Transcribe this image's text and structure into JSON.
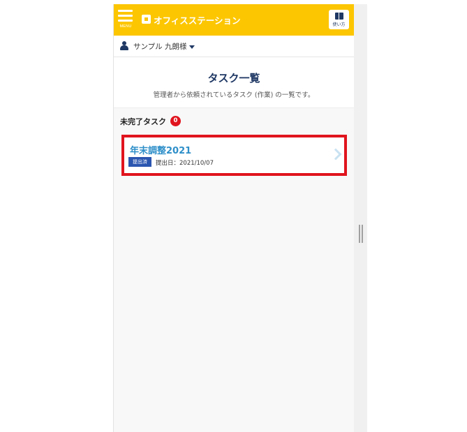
{
  "header": {
    "menu_label": "MENU",
    "app_name": "オフィスステーション",
    "guide_label": "使い方",
    "brand_color": "#fcc600"
  },
  "user": {
    "name": "サンプル 九朗様"
  },
  "page": {
    "title": "タスク一覧",
    "description": "管理者から依頼されているタスク (作業) の一覧です。"
  },
  "pending_section": {
    "label": "未完了タスク",
    "count": "0"
  },
  "tasks": [
    {
      "title": "年末調整2021",
      "status": "提出済",
      "submit_date": "提出日：2021/10/07"
    }
  ],
  "colors": {
    "navy": "#1f3864",
    "link_blue": "#2e8fc9",
    "status_blue": "#2b56b0",
    "highlight_red": "#e0141e"
  },
  "icons": {
    "menu": "hamburger-icon",
    "logo": "office-station-logo-icon",
    "guide": "book-icon",
    "user": "user-icon",
    "dropdown": "caret-down-icon",
    "task_open": "chevron-right-icon"
  }
}
